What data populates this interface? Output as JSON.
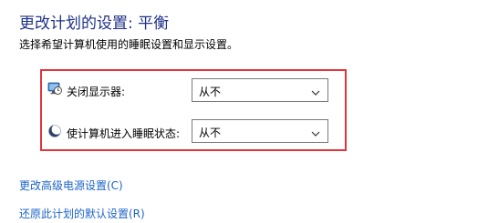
{
  "header": {
    "title": "更改计划的设置: 平衡",
    "subtitle": "选择希望计算机使用的睡眠设置和显示设置。"
  },
  "settings": [
    {
      "label": "关闭显示器:",
      "icon": "monitor-clock-icon",
      "value": "从不"
    },
    {
      "label": "使计算机进入睡眠状态:",
      "icon": "moon-icon",
      "value": "从不"
    }
  ],
  "links": {
    "advanced": "更改高级电源设置(C)",
    "restore": "还原此计划的默认设置(R)"
  },
  "colors": {
    "title": "#1e3287",
    "link": "#1e64c8",
    "highlight": "#e0353b"
  }
}
